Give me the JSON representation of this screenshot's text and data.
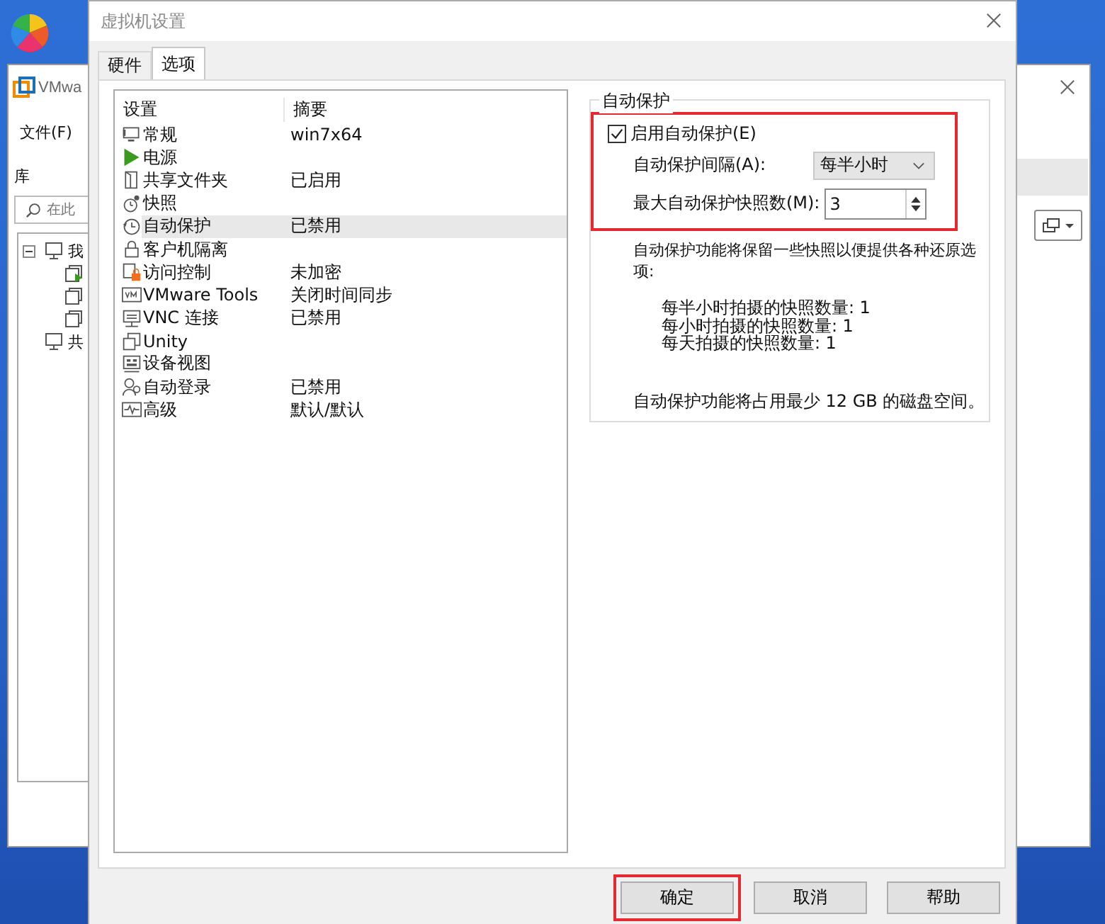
{
  "background_window": {
    "title": "VMwa",
    "menu": [
      "文件(F)"
    ],
    "library_label": "库",
    "search": {
      "placeholder": "在此"
    },
    "tree": [
      {
        "label": "我",
        "expanded": true,
        "children": [
          {
            "running": true
          },
          {
            "running": false
          },
          {
            "running": false
          }
        ]
      },
      {
        "label": "共"
      }
    ]
  },
  "dialog": {
    "title": "虚拟机设置",
    "tabs": [
      {
        "label": "硬件",
        "selected": false
      },
      {
        "label": "选项",
        "selected": true
      }
    ],
    "settings": {
      "columns": [
        "设置",
        "摘要"
      ],
      "rows": [
        {
          "kind": "general",
          "name": "常规",
          "summary": "win7x64",
          "selected": false
        },
        {
          "kind": "power",
          "name": "电源",
          "selected": false
        },
        {
          "kind": "shared",
          "name": "共享文件夹",
          "summary": "已启用",
          "selected": false
        },
        {
          "kind": "snapshot",
          "name": "快照",
          "selected": false
        },
        {
          "kind": "autoprotect",
          "name": "自动保护",
          "summary": "已禁用",
          "selected": true
        },
        {
          "kind": "isolation",
          "name": "客户机隔离",
          "selected": false
        },
        {
          "kind": "access",
          "name": "访问控制",
          "summary": "未加密",
          "selected": false
        },
        {
          "kind": "tools",
          "name": "VMware Tools",
          "summary": "关闭时间同步",
          "selected": false
        },
        {
          "kind": "vnc",
          "name": "VNC 连接",
          "summary": "已禁用",
          "selected": false
        },
        {
          "kind": "unity",
          "name": "Unity",
          "selected": false
        },
        {
          "kind": "devices",
          "name": "设备视图",
          "selected": false
        },
        {
          "kind": "autologin",
          "name": "自动登录",
          "summary": "已禁用",
          "selected": false
        },
        {
          "kind": "advanced",
          "name": "高级",
          "summary": "默认/默认",
          "selected": false
        }
      ]
    },
    "autoprotect": {
      "title": "自动保护",
      "highlighted": true,
      "enable": {
        "label": "启用自动保护(E)",
        "checked": true
      },
      "interval": {
        "label": "自动保护间隔(A):",
        "value": "每半小时"
      },
      "max_snapshots": {
        "label": "最大自动保护快照数(M):",
        "value": "3"
      },
      "description": "自动保护功能将保留一些快照以便提供各种还原选项:",
      "counts": [
        "每半小时拍摄的快照数量: 1",
        "每小时拍摄的快照数量: 1",
        "每天拍摄的快照数量: 1"
      ],
      "disk_note": "自动保护功能将占用最少 12 GB 的磁盘空间。"
    },
    "buttons": [
      {
        "label": "确定",
        "highlighted": true
      },
      {
        "label": "取消",
        "highlighted": false
      },
      {
        "label": "帮助",
        "highlighted": false
      }
    ]
  }
}
